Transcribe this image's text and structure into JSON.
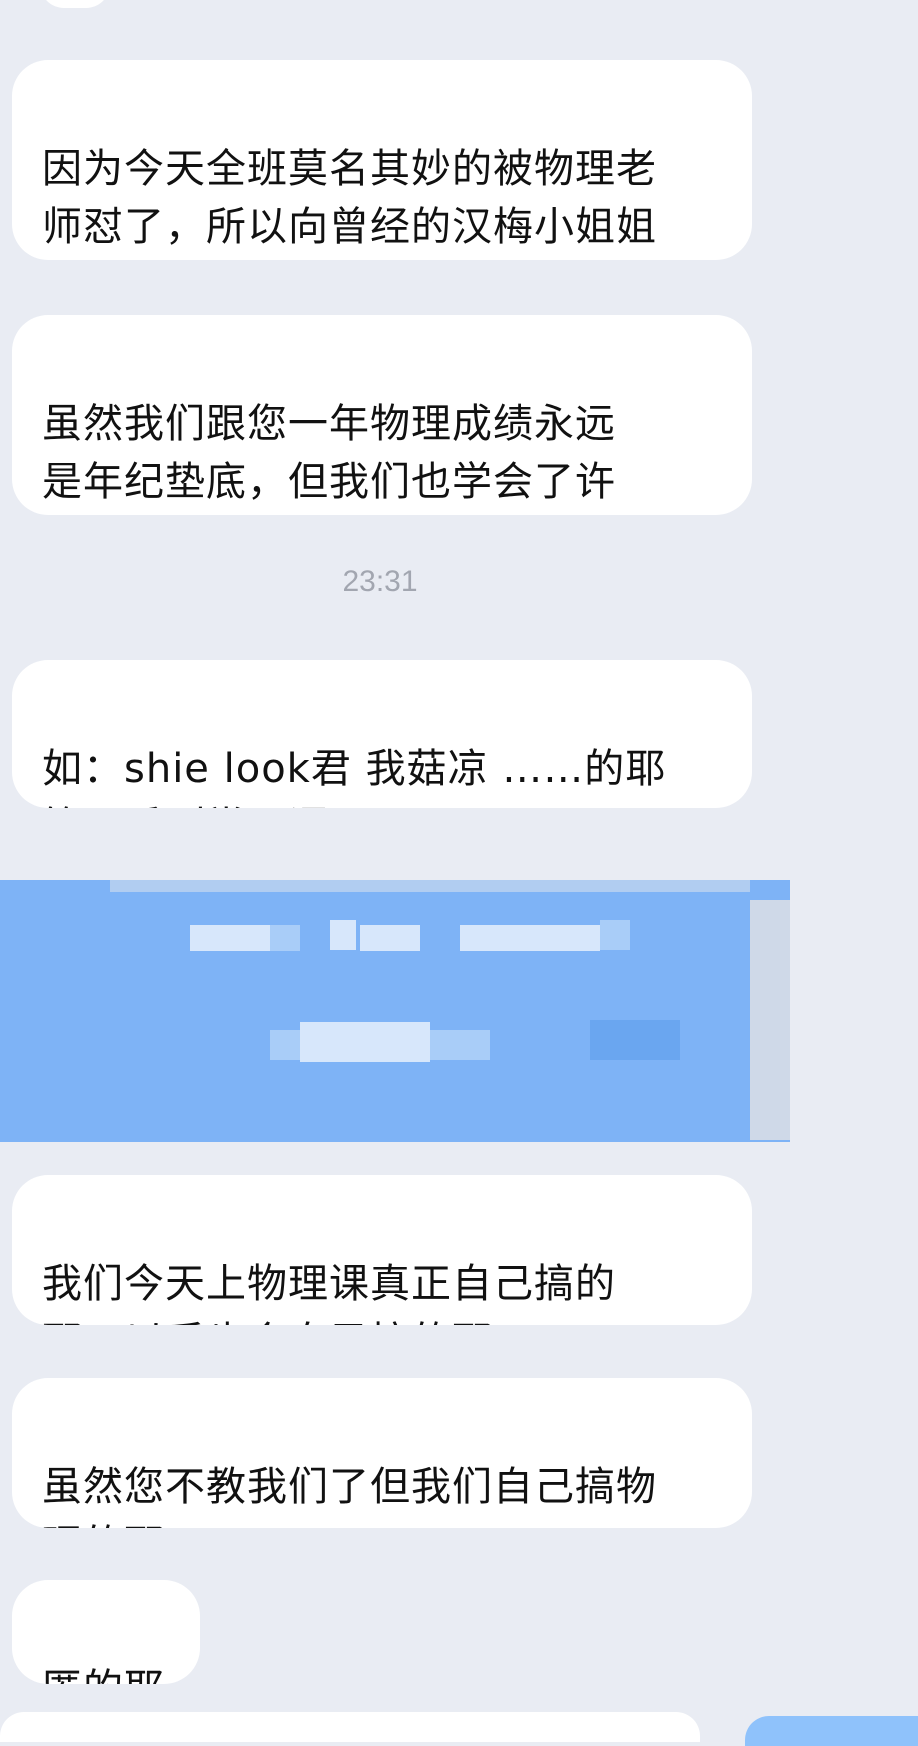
{
  "messages": [
    {
      "id": "m1",
      "text": "因为今天全班莫名其妙的被物理老\n师怼了，所以向曾经的汉梅小姐姐\n表达自己的怀念"
    },
    {
      "id": "m2",
      "text": "虽然我们跟您一年物理成绩永远\n是年纪垫底，但我们也学会了许\n多‘汉语’"
    },
    {
      "id": "m3",
      "text": "如：shie look君 我菇凉  ……的耶\n等一系列常用语"
    },
    {
      "id": "m4",
      "text": "我们今天上物理课真正自己搞的\n耶。以后也会自己搞的耶"
    },
    {
      "id": "m5",
      "text": "虽然您不教我们了但我们自己搞物\n理的耶"
    },
    {
      "id": "m6",
      "text": "匿的耶"
    }
  ],
  "timestamp": "23:31",
  "colors": {
    "background": "#e9ecf3",
    "bubble": "#ffffff",
    "redacted_image": "#7eb3f6",
    "timestamp_text": "#a2a6b0"
  }
}
